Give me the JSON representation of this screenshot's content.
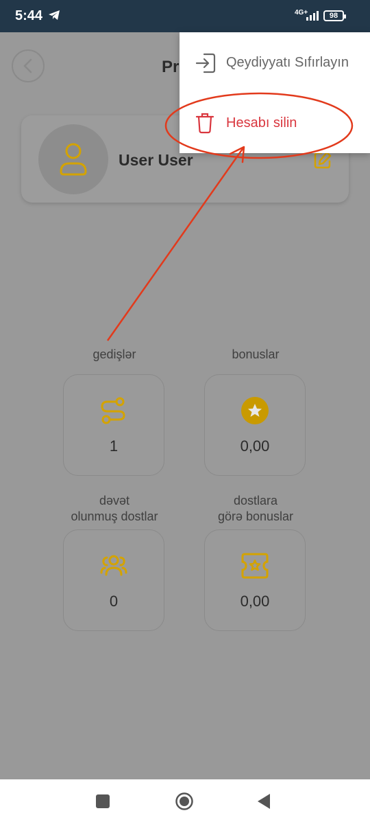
{
  "status_bar": {
    "time": "5:44",
    "network": "4G+",
    "battery": "98"
  },
  "header": {
    "title": "Pr"
  },
  "profile": {
    "name": "User User"
  },
  "stats": [
    {
      "label_line1": "gedişlər",
      "label_line2": "",
      "value": "1",
      "icon": "route-icon"
    },
    {
      "label_line1": "bonuslar",
      "label_line2": "",
      "value": "0,00",
      "icon": "star-badge-icon"
    },
    {
      "label_line1": "dəvət",
      "label_line2": "olunmuş dostlar",
      "value": "0",
      "icon": "users-icon"
    },
    {
      "label_line1": "dostlara",
      "label_line2": "görə bonuslar",
      "value": "0,00",
      "icon": "ticket-star-icon"
    }
  ],
  "menu": {
    "items": [
      {
        "label": "Qeydiyyatı Sıfırlayın",
        "icon": "sign-in-icon",
        "color": "#666666"
      },
      {
        "label": "Hesabı silin",
        "icon": "trash-icon",
        "color": "#d9363e"
      }
    ]
  },
  "colors": {
    "accent": "#d4a300",
    "status_bar": "#223749",
    "scrim": "#999999",
    "annotation": "#e23a1c",
    "danger": "#d9363e"
  }
}
